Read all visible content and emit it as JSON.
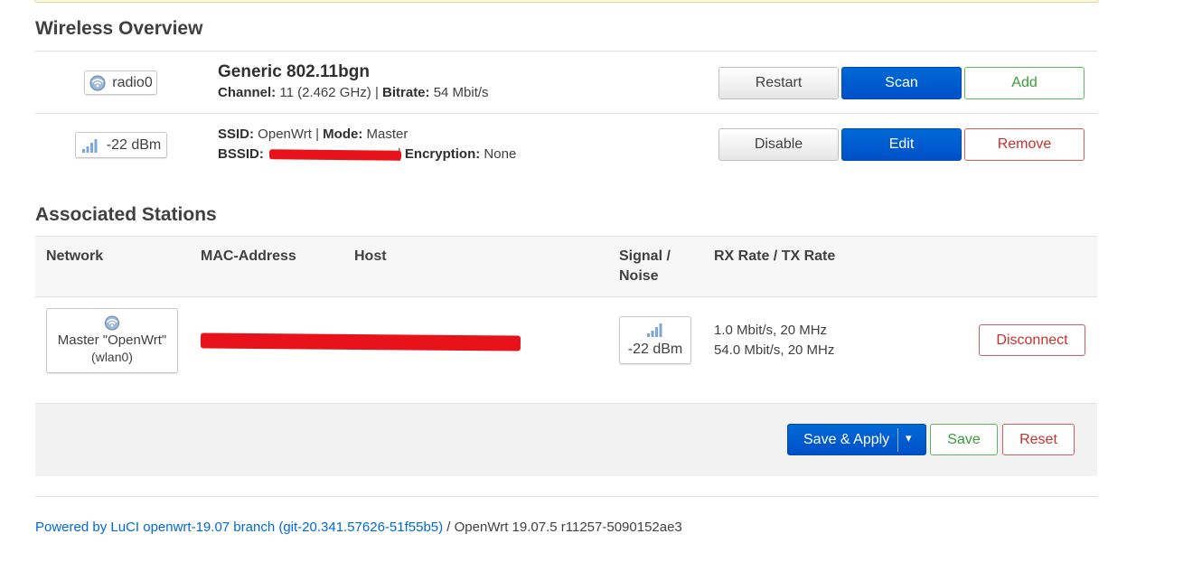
{
  "overview": {
    "title": "Wireless Overview",
    "radio": {
      "badge": "radio0",
      "badge_icon": "wifi-icon",
      "name": "Generic 802.11bgn",
      "channel_label": "Channel:",
      "channel_value": " 11 (2.462 GHz) | ",
      "bitrate_label": "Bitrate:",
      "bitrate_value": " 54 Mbit/s",
      "buttons": {
        "restart": "Restart",
        "scan": "Scan",
        "add": "Add"
      }
    },
    "network": {
      "badge": "-22 dBm",
      "badge_icon": "signal-icon",
      "ssid_label": "SSID:",
      "ssid_value": " OpenWrt | ",
      "mode_label": "Mode:",
      "mode_value": " Master",
      "bssid_label": "BSSID:",
      "sep": "| ",
      "encryption_label": "Encryption:",
      "encryption_value": " None",
      "buttons": {
        "disable": "Disable",
        "edit": "Edit",
        "remove": "Remove"
      }
    }
  },
  "stations": {
    "title": "Associated Stations",
    "columns": {
      "network": "Network",
      "mac": "MAC-Address",
      "host": "Host",
      "signal_line1": "Signal /",
      "signal_line2": "Noise",
      "rate": "RX Rate / TX Rate"
    },
    "rows": [
      {
        "network_line1": "Master \"OpenWrt\"",
        "network_line2": "(wlan0)",
        "signal": "-22 dBm",
        "rx_rate": "1.0 Mbit/s, 20 MHz",
        "tx_rate": "54.0 Mbit/s, 20 MHz",
        "disconnect": "Disconnect"
      }
    ]
  },
  "actions": {
    "save_apply": "Save & Apply",
    "dropdown": "▾",
    "save": "Save",
    "reset": "Reset"
  },
  "footer": {
    "link": "Powered by LuCI openwrt-19.07 branch (git-20.341.57626-51f55b5)",
    "version": " / OpenWrt 19.07.5 r11257-5090152ae3"
  },
  "colors": {
    "primary": "#0058d0",
    "positive": "#3a9b3a",
    "negative": "#c9302c",
    "redaction": "#e8131a"
  }
}
